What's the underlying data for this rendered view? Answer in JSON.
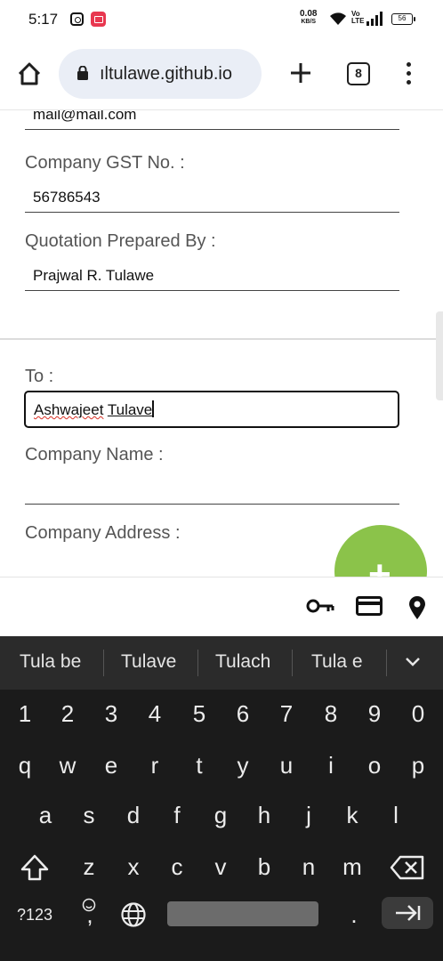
{
  "status_bar": {
    "time": "5:17",
    "net_speed": "0.08",
    "net_unit": "KB/S",
    "volte": "Vo",
    "volte_sub": "LTE",
    "battery": "56"
  },
  "browser": {
    "url": "ıltulawe.github.io",
    "tab_count": "8"
  },
  "form": {
    "email_value": "mail@mail.com",
    "gst_label": "Company GST No. :",
    "gst_value": "56786543",
    "prepared_by_label": "Quotation Prepared By :",
    "prepared_by_value": "Prajwal R. Tulawe",
    "to_label": "To :",
    "to_value_word1": "Ashwajeet",
    "to_value_word2": "Tulave",
    "company_name_label": "Company Name :",
    "company_name_value": "",
    "company_address_label": "Company Address :"
  },
  "fab": {
    "label": "+"
  },
  "keyboard": {
    "suggestions": [
      "Tula be",
      "Tulave",
      "Tulach",
      "Tula e"
    ],
    "row_numbers": [
      "1",
      "2",
      "3",
      "4",
      "5",
      "6",
      "7",
      "8",
      "9",
      "0"
    ],
    "row1": [
      "q",
      "w",
      "e",
      "r",
      "t",
      "y",
      "u",
      "i",
      "o",
      "p"
    ],
    "row2": [
      "a",
      "s",
      "d",
      "f",
      "g",
      "h",
      "j",
      "k",
      "l"
    ],
    "row3": [
      "z",
      "x",
      "c",
      "v",
      "b",
      "n",
      "m"
    ],
    "symbols_key": "?123",
    "comma_key": ",",
    "period_key": "."
  },
  "colors": {
    "fab": "#8bc34a",
    "keyboard_bg": "#1b1b1b",
    "url_bar": "#eaeef6",
    "spell_error": "#d93025"
  }
}
